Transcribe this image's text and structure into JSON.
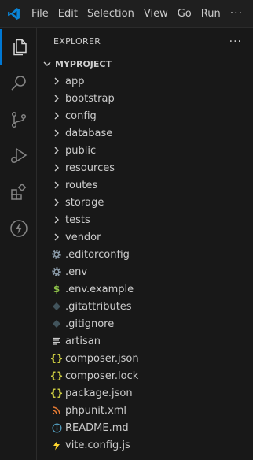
{
  "menu": {
    "items": [
      "File",
      "Edit",
      "Selection",
      "View",
      "Go",
      "Run"
    ],
    "more": "···"
  },
  "sidebar": {
    "title": "EXPLORER",
    "more": "···",
    "project": "MYPROJECT",
    "folders": [
      "app",
      "bootstrap",
      "config",
      "database",
      "public",
      "resources",
      "routes",
      "storage",
      "tests",
      "vendor"
    ],
    "files": [
      {
        "name": ".editorconfig",
        "icon": "gear-icon"
      },
      {
        "name": ".env",
        "icon": "gear-icon"
      },
      {
        "name": ".env.example",
        "icon": "dollar-icon"
      },
      {
        "name": ".gitattributes",
        "icon": "git-diamond-icon"
      },
      {
        "name": ".gitignore",
        "icon": "git-diamond-icon"
      },
      {
        "name": "artisan",
        "icon": "lines-icon"
      },
      {
        "name": "composer.json",
        "icon": "braces-icon"
      },
      {
        "name": "composer.lock",
        "icon": "braces-icon"
      },
      {
        "name": "package.json",
        "icon": "braces-icon"
      },
      {
        "name": "phpunit.xml",
        "icon": "rss-icon"
      },
      {
        "name": "README.md",
        "icon": "info-icon"
      },
      {
        "name": "vite.config.js",
        "icon": "vite-icon"
      }
    ]
  },
  "colors": {
    "accent": "#0078d4",
    "braces": "#cbcb41",
    "dollar": "#8dc149",
    "rss": "#e37933",
    "info": "#519aba",
    "vite": "#ffd62e"
  }
}
